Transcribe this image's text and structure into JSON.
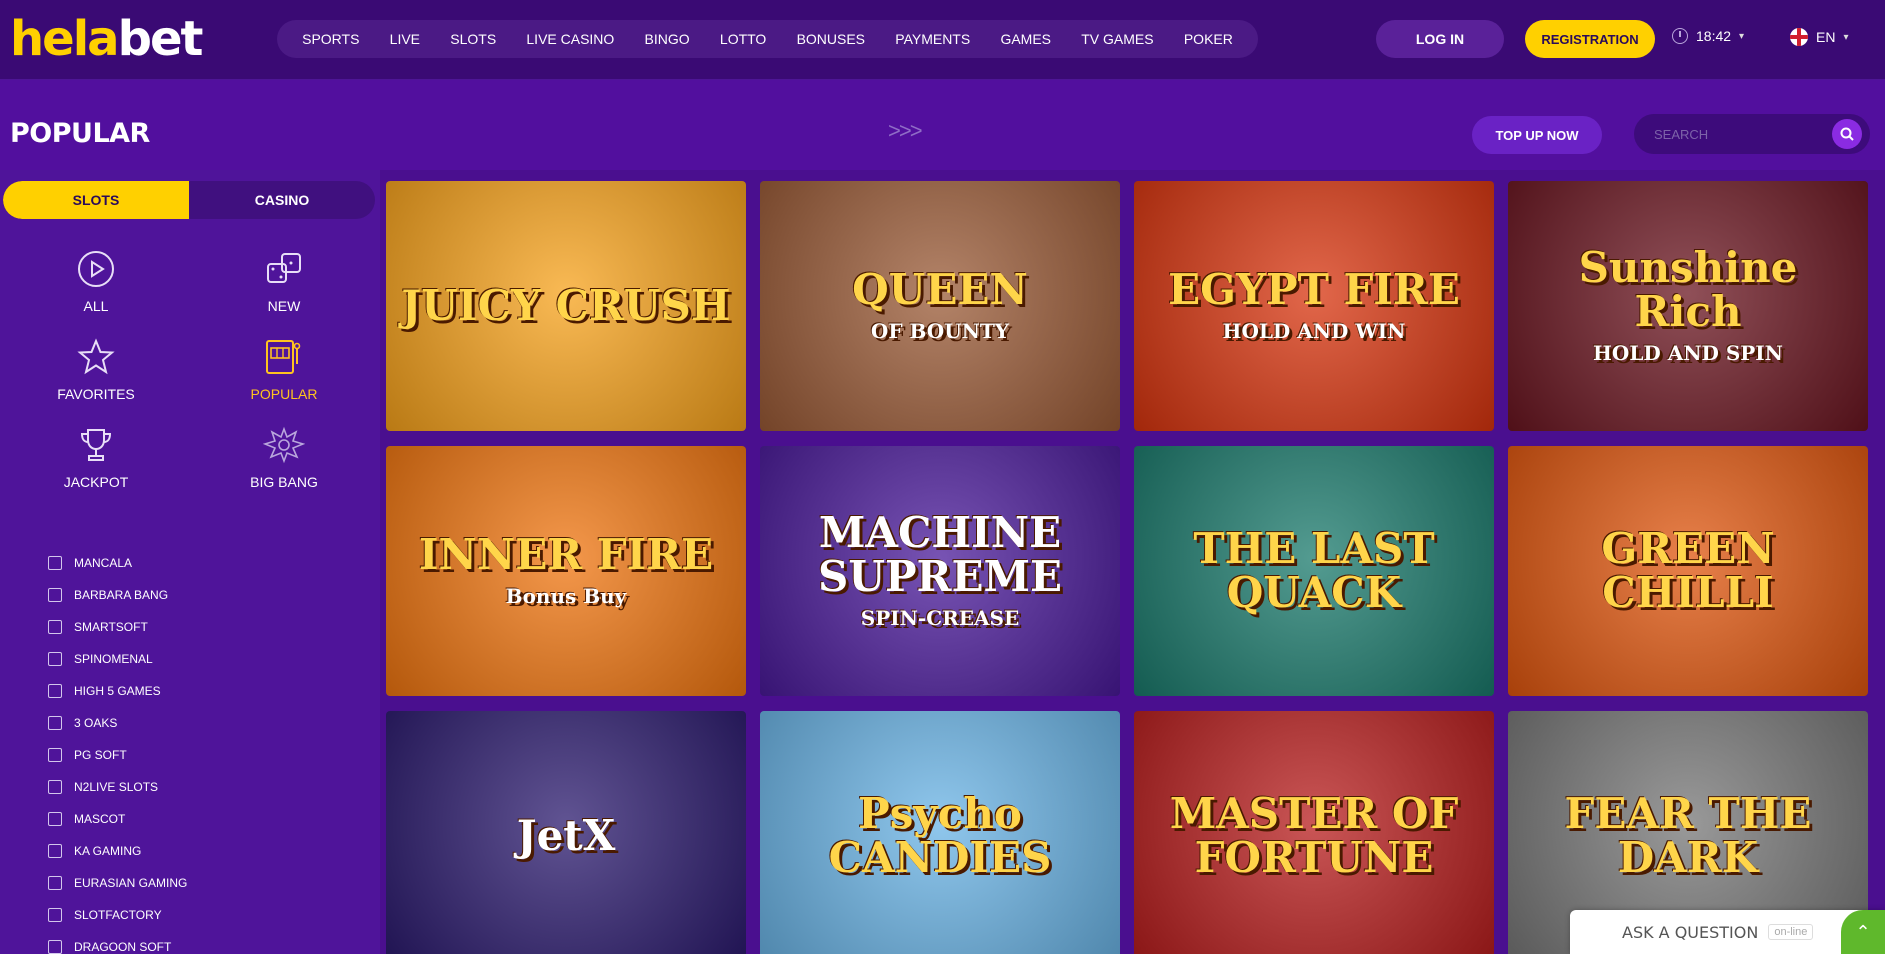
{
  "brand": {
    "logo_part1": "hela",
    "logo_part2": "bet"
  },
  "nav": [
    "SPORTS",
    "LIVE",
    "SLOTS",
    "LIVE CASINO",
    "BINGO",
    "LOTTO",
    "BONUSES",
    "PAYMENTS",
    "GAMES",
    "TV GAMES",
    "POKER"
  ],
  "header": {
    "login_label": "LOG IN",
    "register_label": "REGISTRATION",
    "time": "18:42",
    "language": "EN"
  },
  "page": {
    "title": "POPULAR",
    "arrows": ">>>",
    "topup_label": "TOP UP NOW",
    "search_placeholder": "SEARCH"
  },
  "tabs": {
    "slots": "SLOTS",
    "casino": "CASINO"
  },
  "categories": [
    {
      "label": "ALL",
      "icon": "play-icon"
    },
    {
      "label": "NEW",
      "icon": "dice-icon"
    },
    {
      "label": "FAVORITES",
      "icon": "star-icon"
    },
    {
      "label": "POPULAR",
      "icon": "slot-machine-icon",
      "active": true
    },
    {
      "label": "JACKPOT",
      "icon": "trophy-icon"
    },
    {
      "label": "BIG BANG",
      "icon": "big-bang-icon"
    }
  ],
  "providers": [
    "MANCALA",
    "BARBARA BANG",
    "SMARTSOFT",
    "SPINOMENAL",
    "HIGH 5 GAMES",
    "3 OAKS",
    "PG SOFT",
    "N2LIVE SLOTS",
    "MASCOT",
    "KA GAMING",
    "EURASIAN GAMING",
    "SLOTFACTORY",
    "DRAGOON SOFT"
  ],
  "games": [
    {
      "title": "JUICY CRUSH",
      "sub": "",
      "bg": "#f7a21b"
    },
    {
      "title": "QUEEN",
      "sub": "OF BOUNTY",
      "bg": "#9a5a36"
    },
    {
      "title": "EGYPT FIRE",
      "sub": "HOLD AND WIN",
      "bg": "#d8340e"
    },
    {
      "title": "Sunshine Rich",
      "sub": "HOLD AND SPIN",
      "bg": "#6a1520"
    },
    {
      "title": "INNER FIRE",
      "sub": "Bonus Buy",
      "bg": "#f0750f"
    },
    {
      "title": "MACHINE SUPREME",
      "sub": "SPIN-CREASE",
      "bg": "#4a1a9a"
    },
    {
      "title": "THE LAST QUACK",
      "sub": "",
      "bg": "#1a7a6c"
    },
    {
      "title": "GREEN CHILLI",
      "sub": "",
      "bg": "#e0560e"
    },
    {
      "title": "JetX",
      "sub": "",
      "bg": "#2b1a6e"
    },
    {
      "title": "Psycho CANDIES",
      "sub": "",
      "bg": "#6ab4e6"
    },
    {
      "title": "MASTER OF FORTUNE",
      "sub": "",
      "bg": "#b81d1d"
    },
    {
      "title": "FEAR THE DARK",
      "sub": "",
      "bg": "#777777"
    }
  ],
  "chat": {
    "label": "ASK A QUESTION",
    "status": "on-line"
  },
  "colors": {
    "accent": "#ffd000",
    "bg": "#4a0f8f",
    "header": "#3a0a74"
  }
}
